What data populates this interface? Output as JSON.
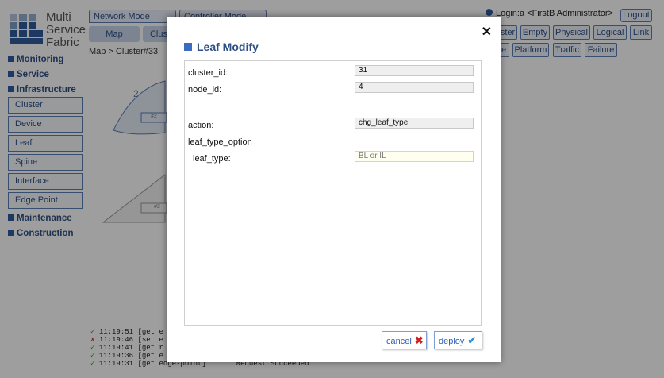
{
  "logo": {
    "line1": "Multi",
    "line2": "Service",
    "line3": "Fabric"
  },
  "header": {
    "modes": [
      "Network Mode",
      "Controller Mode"
    ],
    "subtabs": [
      "Map",
      "Clus"
    ],
    "breadcrumb": "Map > Cluster#33",
    "login": "Login:a <FirstB Administrator>",
    "logout": "Logout"
  },
  "sidebar": {
    "sections": [
      "Monitoring",
      "Service",
      "Infrastructure"
    ],
    "items": [
      "Cluster",
      "Device",
      "Leaf",
      "Spine",
      "Interface",
      "Edge Point"
    ],
    "bottom_sections": [
      "Maintenance",
      "Construction"
    ]
  },
  "view_buttons_row1": [
    "ster",
    "Empty",
    "Physical",
    "Logical",
    "Link"
  ],
  "view_buttons_row2": [
    "e",
    "Platform",
    "Traffic",
    "Failure"
  ],
  "map": {
    "numbers": [
      "2",
      "#2",
      "#2"
    ]
  },
  "console": [
    {
      "status": "ok",
      "time": "11:19:51",
      "text": "[get e"
    },
    {
      "status": "err",
      "time": "11:19:46",
      "text": "[set e"
    },
    {
      "status": "ok",
      "time": "11:19:41",
      "text": "[get r"
    },
    {
      "status": "ok",
      "time": "11:19:36",
      "text": "[get e"
    },
    {
      "status": "ok",
      "time": "11:19:31",
      "text": "[get edge-point]",
      "result": "Request Succeeded"
    }
  ],
  "modal": {
    "title": "Leaf Modify",
    "close": "✕",
    "fields": {
      "cluster_id_label": "cluster_id:",
      "cluster_id_value": "31",
      "node_id_label": "node_id:",
      "node_id_value": "4",
      "action_label": "action:",
      "action_value": "chg_leaf_type",
      "group_label": "leaf_type_option",
      "leaf_type_label": "leaf_type:",
      "leaf_type_placeholder": "BL or IL"
    },
    "cancel_label": "cancel",
    "deploy_label": "deploy"
  },
  "colors": {
    "brand": "#2f5d9e",
    "accent": "#3a6dbf",
    "ok": "#3a9a3a",
    "error": "#d02020"
  }
}
